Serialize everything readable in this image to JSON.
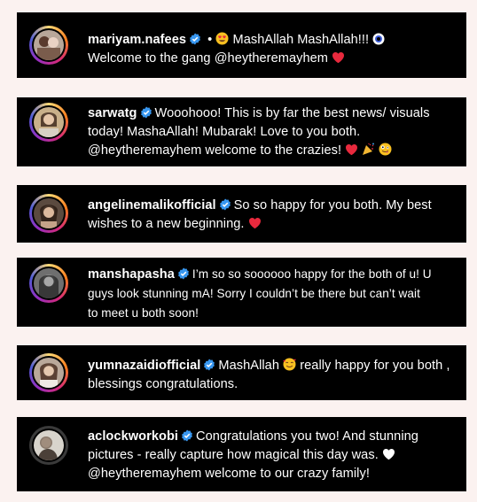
{
  "comments": [
    {
      "username": "mariyam.nafees",
      "separator": "•",
      "text_1": "MashAllah MashAllah!!!",
      "text_2": "Welcome to the gang @heytheremayhem"
    },
    {
      "username": "sarwatg",
      "line_1": "Wooohooo! This is by far the best news/ visuals",
      "line_2": "today! MashaAllah! Mubarak! Love to you both.",
      "line_3": "@heytheremayhem welcome to the crazies!"
    },
    {
      "username": "angelinemalikofficial",
      "line_1": "So so happy for you both. My best",
      "line_2": "wishes to a new beginning."
    },
    {
      "username": "manshapasha",
      "line_1": "I’m so so soooooo happy for the both of u! U",
      "line_2": "guys look stunning mA! Sorry I couldn’t be there but can’t wait",
      "line_3": "to meet u both soon!"
    },
    {
      "username": "yumnazaidiofficial",
      "line_1a": "MashAllah",
      "line_1b": "really happy for you both ,",
      "line_2": "blessings congratulations."
    },
    {
      "username": "aclockworkobi",
      "line_1": "Congratulations you two! And stunning",
      "line_2": "pictures - really capture how magical this day was.",
      "line_3": "@heytheremayhem welcome to our crazy family!"
    }
  ],
  "colors": {
    "page_background": "#fbf2f0",
    "card_background": "#000000",
    "text": "#ffffff",
    "verified_badge": "#3897f0",
    "heart_red": "#e8293d"
  }
}
